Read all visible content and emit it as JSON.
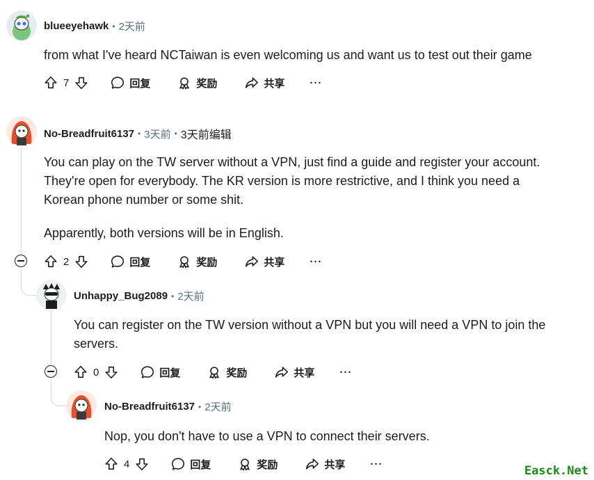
{
  "comments": [
    {
      "username": "blueeyehawk",
      "time": "2天前",
      "body": [
        "from what I've heard NCTaiwan is even welcoming us and want us to test out their game"
      ],
      "votes": "7"
    },
    {
      "username": "No-Breadfruit6137",
      "time": "3天前",
      "edited_time": "3天前编辑",
      "body": [
        "You can play on the TW server without a VPN, just find a guide and register your account.",
        "They're open for everybody. The KR version is more restrictive, and I think you need a",
        "Korean phone number or some shit."
      ],
      "body2": "Apparently, both versions will be in English.",
      "votes": "2"
    },
    {
      "username": "Unhappy_Bug2089",
      "time": "2天前",
      "body": [
        "You can register on the TW version without a VPN but you will need a VPN to join the",
        "servers."
      ],
      "votes": "0"
    },
    {
      "username": "No-Breadfruit6137",
      "time": "2天前",
      "body": [
        "Nop, you don't have to use a VPN to connect their servers."
      ],
      "votes": "4"
    }
  ],
  "actions": {
    "reply": "回复",
    "award": "奖励",
    "share": "共享",
    "more": "···"
  },
  "icons": [
    "upvote-icon",
    "downvote-icon",
    "reply-icon",
    "award-icon",
    "share-icon",
    "more-icon",
    "collapse-icon"
  ],
  "colors": {
    "text": "#1c1c1c",
    "meta": "#576f76",
    "thread": "#d2d8dc",
    "watermark": "#1a8a1a"
  },
  "watermark": "Easck.Net"
}
